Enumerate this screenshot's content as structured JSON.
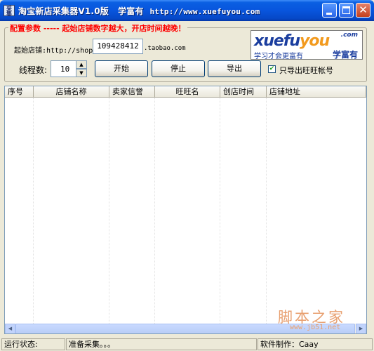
{
  "window": {
    "icon_text": "采集",
    "title": "淘宝新店采集器V1.0版",
    "subtitle": "学富有",
    "url": "http://www.xuefuyou.com"
  },
  "config": {
    "group_title": "配置参数 ----- 起始店铺数字越大，开店时间越晚！",
    "start_label": "起始店铺:http://shop",
    "start_value": "109428412",
    "domain_suffix": ".taobao.com",
    "threads_label": "线程数:",
    "threads_value": "10",
    "start_button": "开始",
    "stop_button": "停止",
    "export_button": "导出",
    "checkbox_label": "只导出旺旺帐号",
    "checkbox_checked": true
  },
  "logo": {
    "word_xue": "xue",
    "word_fu": "fu",
    "word_you": "you",
    "com": ".com",
    "slogan": "学习才会更富有",
    "cn_name": "学富有"
  },
  "table": {
    "columns": [
      "序号",
      "店铺名称",
      "卖家信誉",
      "旺旺名",
      "创店时间",
      "店铺地址"
    ]
  },
  "watermark": {
    "big": "脚本之家",
    "small": "www.jb51.net"
  },
  "status": {
    "label": "运行状态:",
    "message": "准备采集。。。",
    "author": "软件制作：Caay"
  },
  "colors": {
    "group_title": "#ff0000",
    "logo_blue": "#1a3d9e",
    "logo_orange": "#f29a1e"
  }
}
